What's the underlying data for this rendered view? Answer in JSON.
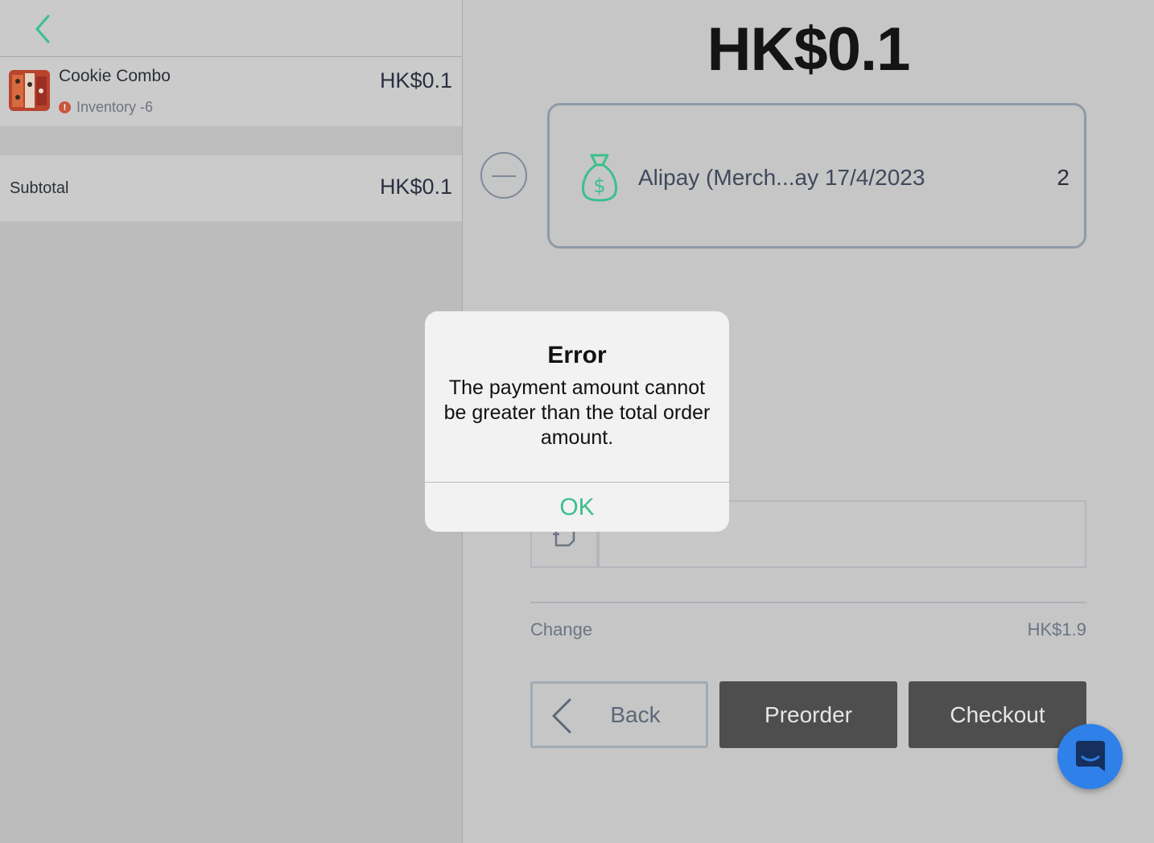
{
  "cart": {
    "item": {
      "name": "Cookie Combo",
      "inventory": "Inventory -6",
      "price": "HK$0.1"
    },
    "subtotal_label": "Subtotal",
    "subtotal_value": "HK$0.1"
  },
  "payment": {
    "total": "HK$0.1",
    "method_label": "Alipay (Merch...ay 17/4/2023",
    "method_count": "2",
    "change_label": "Change",
    "change_value": "HK$1.9",
    "back_label": "Back",
    "preorder_label": "Preorder",
    "checkout_label": "Checkout"
  },
  "alert": {
    "title": "Error",
    "message": "The payment amount cannot be greater than the total order amount.",
    "ok_label": "OK"
  },
  "icons": {
    "back": "chevron-left-icon",
    "warning": "warning-icon",
    "remove": "minus-circle-icon",
    "money": "money-bag-icon",
    "note": "note-icon",
    "chat": "chat-icon"
  },
  "colors": {
    "accent_green": "#3bbf8e",
    "warning_red": "#c8553d",
    "dark_button": "#4e4e4e",
    "chat_blue": "#2f80e8"
  }
}
